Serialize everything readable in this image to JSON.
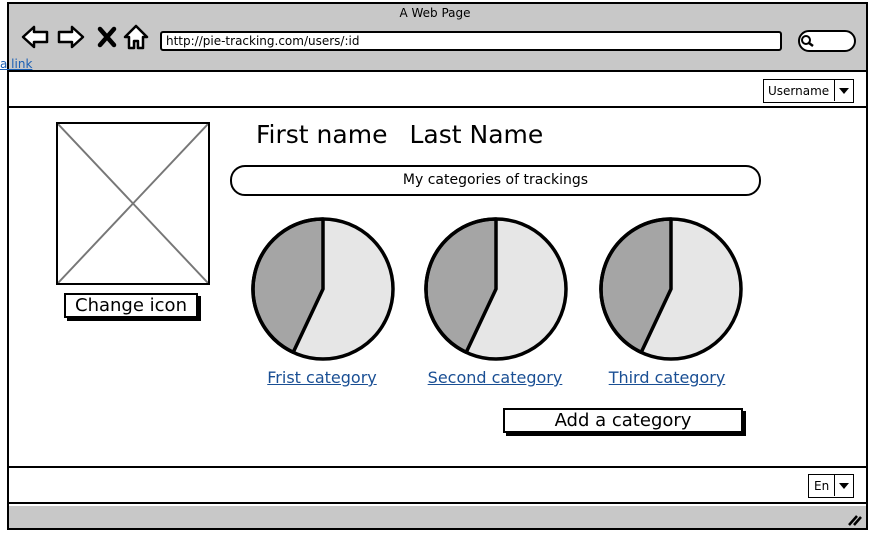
{
  "browser": {
    "title": "A Web Page",
    "url": "http://pie-tracking.com/users/:id",
    "link_text": "a link"
  },
  "header": {
    "username_select": {
      "selected": "Username"
    }
  },
  "profile": {
    "first_name": "First name",
    "last_name": "Last Name",
    "change_icon_label": "Change icon"
  },
  "categories": {
    "heading": "My categories of trackings",
    "items": [
      {
        "label": "Frist category",
        "dark_fraction": 0.43
      },
      {
        "label": "Second category",
        "dark_fraction": 0.43
      },
      {
        "label": "Third category",
        "dark_fraction": 0.43
      }
    ],
    "add_label": "Add a category"
  },
  "footer": {
    "language_select": {
      "selected": "En"
    }
  },
  "colors": {
    "chrome_gray": "#c8c8c8",
    "pie_dark": "#a5a5a5",
    "pie_light": "#e6e6e6",
    "link_blue": "#1a4f94"
  }
}
